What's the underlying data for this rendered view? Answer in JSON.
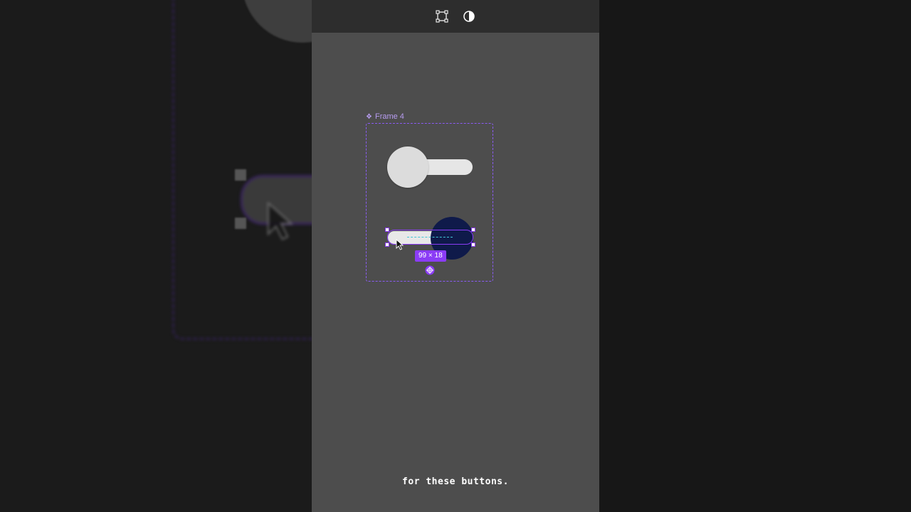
{
  "toolbar": {
    "frame_tool_icon": "frame-tool-icon",
    "contrast_icon": "contrast-toggle-icon"
  },
  "canvas": {
    "frame_label": "Frame 4",
    "frame_icon": "component-diamond-icon",
    "selection_size": "99 × 18",
    "anchor_icon": "crosshair-icon",
    "accent_color": "#8b3cf6",
    "toggle_knob_dark": "#0f1a4a",
    "toggle_track_light": "#e8e8e8"
  },
  "caption": {
    "text": "for these buttons."
  }
}
